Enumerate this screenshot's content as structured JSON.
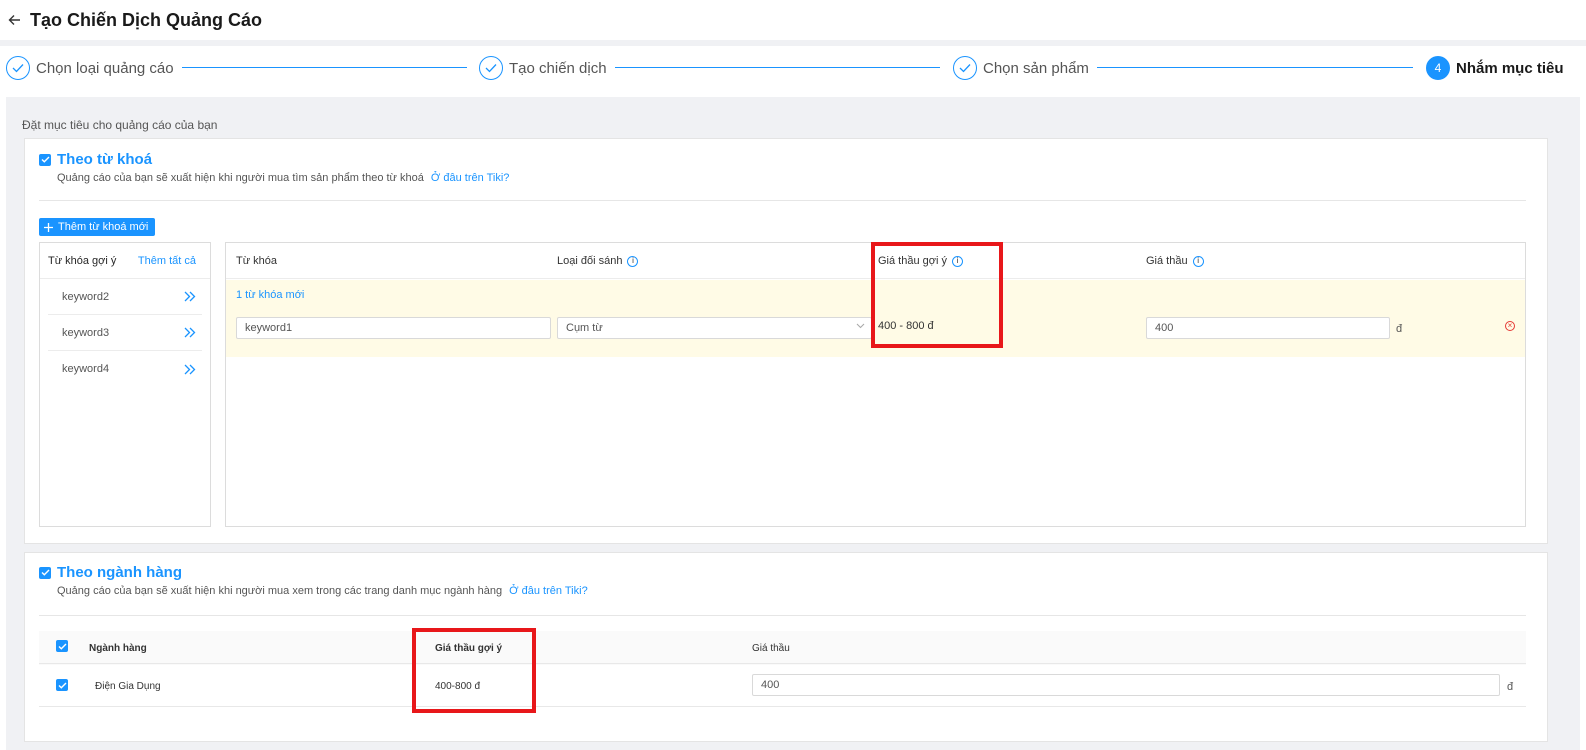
{
  "header": {
    "title": "Tạo Chiến Dịch Quảng Cáo"
  },
  "steps": [
    {
      "label": "Chọn loại quảng cáo",
      "state": "done"
    },
    {
      "label": "Tạo chiến dịch",
      "state": "done"
    },
    {
      "label": "Chọn sản phẩm",
      "state": "done"
    },
    {
      "label": "Nhắm mục tiêu",
      "state": "active",
      "number": "4"
    }
  ],
  "section_heading": "Đặt mục tiêu cho quảng cáo của bạn",
  "keyword_section": {
    "title": "Theo từ khoá",
    "checked": true,
    "description": "Quảng cáo của bạn sẽ xuất hiện khi người mua tìm sản phẩm theo từ khoá",
    "where_link": "Ở đâu trên Tiki?",
    "add_button": "Thêm từ khoá mới",
    "suggestions": {
      "header": "Từ khóa gợi ý",
      "add_all": "Thêm tất cả",
      "items": [
        "keyword2",
        "keyword3",
        "keyword4"
      ]
    },
    "table": {
      "columns": {
        "keyword": "Từ khóa",
        "match_type": "Loại đối sánh",
        "suggested_bid": "Giá thầu gợi ý",
        "bid": "Giá thầu"
      },
      "new_count": "1 từ khóa mới",
      "row": {
        "keyword": "keyword1",
        "match_type": "Cụm từ",
        "suggested_bid": "400 - 800 đ",
        "bid": "400",
        "unit": "đ"
      }
    }
  },
  "category_section": {
    "title": "Theo ngành hàng",
    "checked": true,
    "description": "Quảng cáo của bạn sẽ xuất hiện khi người mua xem trong các trang danh mục ngành hàng",
    "where_link": "Ở đâu trên Tiki?",
    "table": {
      "columns": {
        "category": "Ngành hàng",
        "suggested_bid": "Giá thầu gợi ý",
        "bid": "Giá thầu"
      },
      "row": {
        "category": "Điện Gia Dụng",
        "suggested_bid": "400-800 đ",
        "bid": "400",
        "unit": "đ"
      }
    }
  },
  "colors": {
    "accent": "#1a94ff",
    "highlight": "#e8171a",
    "row_highlight": "#fffbe6",
    "background": "#f0f1f4"
  }
}
